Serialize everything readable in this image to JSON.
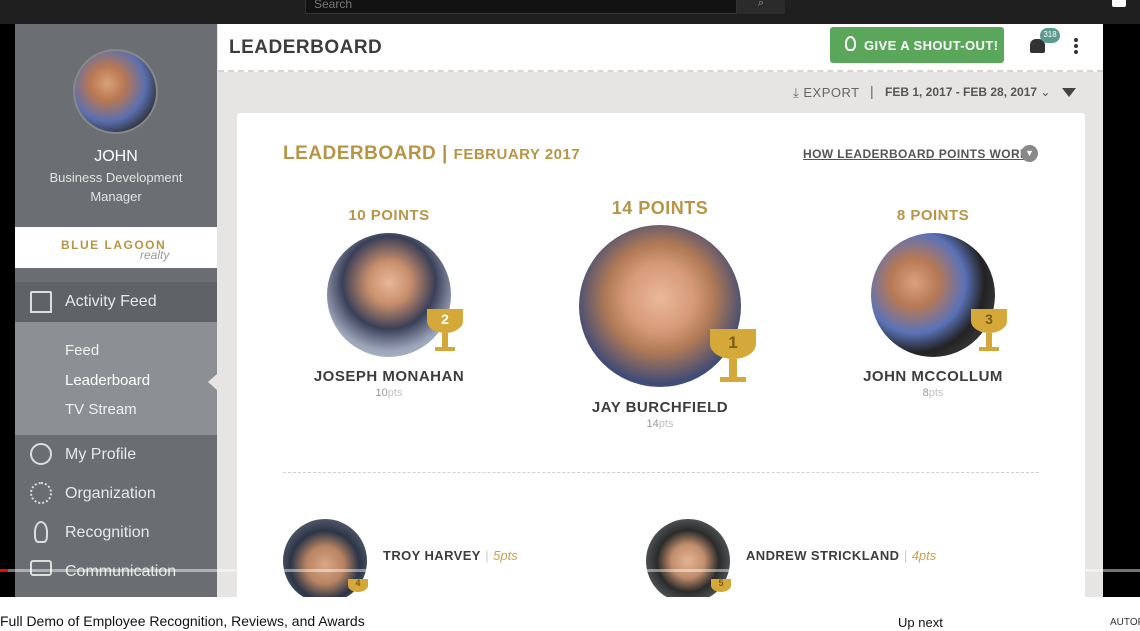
{
  "topbar": {
    "search_placeholder": "Search"
  },
  "sidebar": {
    "user_name": "JOHN",
    "user_title": "Business Development Manager",
    "brand_main": "BLUE LAGOON",
    "brand_sub": "realty",
    "nav": {
      "activity_feed": "Activity Feed",
      "sub_items": [
        "Feed",
        "Leaderboard",
        "TV Stream"
      ],
      "my_profile": "My Profile",
      "organization": "Organization",
      "recognition": "Recognition",
      "communication": "Communication"
    }
  },
  "header": {
    "title": "LEADERBOARD",
    "shout_button": "GIVE A SHOUT-OUT!",
    "notification_count": "318"
  },
  "toolbar": {
    "export": "EXPORT",
    "separator": "|",
    "date_range": "FEB 1, 2017 - FEB 28, 2017"
  },
  "card": {
    "title": "LEADERBOARD |",
    "subtitle": "FEBRUARY 2017",
    "how_link": "HOW LEADERBOARD POINTS WORK",
    "podium": [
      {
        "rank": "2",
        "points_label": "10 POINTS",
        "name": "JOSEPH MONAHAN",
        "pts_num": "10",
        "pts_unit": "pts"
      },
      {
        "rank": "1",
        "points_label": "14 POINTS",
        "name": "JAY BURCHFIELD",
        "pts_num": "14",
        "pts_unit": "pts"
      },
      {
        "rank": "3",
        "points_label": "8 POINTS",
        "name": "JOHN MCCOLLUM",
        "pts_num": "8",
        "pts_unit": "pts"
      }
    ],
    "rows": [
      {
        "rank": "4",
        "name": "TROY HARVEY",
        "sep": "|",
        "pts": "5pts"
      },
      {
        "rank": "5",
        "name": "ANDREW STRICKLAND",
        "sep": "|",
        "pts": "4pts"
      }
    ]
  },
  "video": {
    "title": "Full Demo of Employee Recognition, Reviews, and Awards",
    "up_next": "Up next",
    "autoplay": "AUTOPLAY"
  },
  "colors": {
    "gold": "#b89545",
    "green_button": "#5aa75c",
    "sidebar": "#6a6d72"
  }
}
